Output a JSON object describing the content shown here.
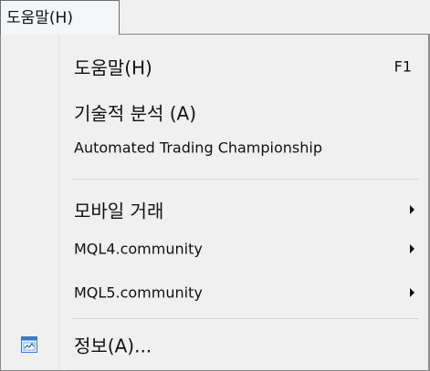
{
  "menubar": {
    "help_menu_label": "도움말(H)"
  },
  "menu": {
    "items": [
      {
        "label": "도움말(H)",
        "shortcut": "F1"
      },
      {
        "label": "기술적 분석 (A)"
      },
      {
        "label": "Automated Trading Championship"
      },
      {
        "label": "모바일 거래",
        "has_submenu": true
      },
      {
        "label": "MQL4.community",
        "has_submenu": true
      },
      {
        "label": "MQL5.community",
        "has_submenu": true
      },
      {
        "label": "정보(A)...",
        "icon": "about-info-icon"
      }
    ]
  },
  "colors": {
    "menu_background": "#f0f0f0",
    "icon_blue": "#3a78c8"
  }
}
